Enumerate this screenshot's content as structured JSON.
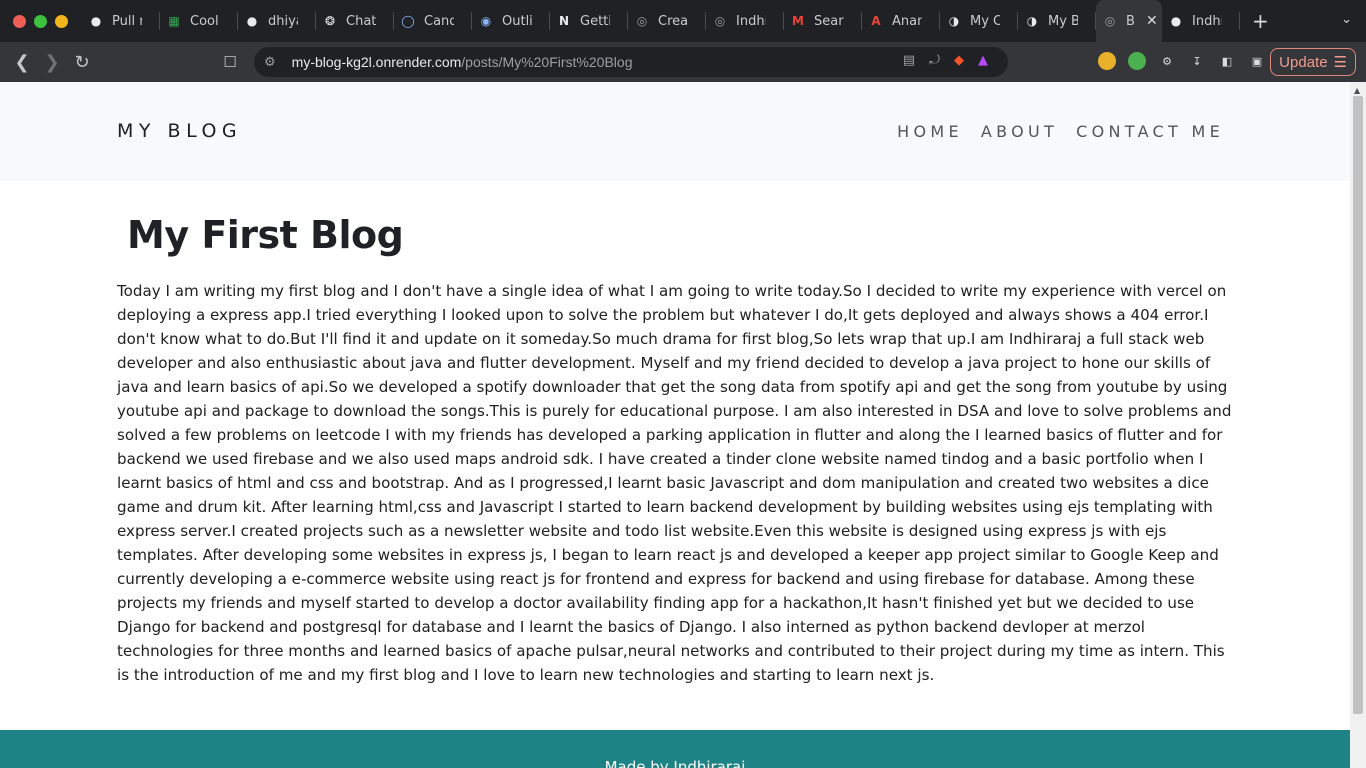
{
  "browser": {
    "tabs": [
      {
        "title": "Pull r",
        "icon": "github-icon",
        "color": "#e8eaed"
      },
      {
        "title": "Cool",
        "icon": "sheets-icon",
        "color": "#34a853"
      },
      {
        "title": "dhiya",
        "icon": "github-icon",
        "color": "#e8eaed"
      },
      {
        "title": "Chat",
        "icon": "chatgpt-icon",
        "color": "#e8eaed"
      },
      {
        "title": "Cand",
        "icon": "candidate-icon",
        "color": "#8ab4f8"
      },
      {
        "title": "Outli",
        "icon": "outlier-icon",
        "color": "#8ab4f8"
      },
      {
        "title": "Getti",
        "icon": "next-icon",
        "color": "#e8eaed"
      },
      {
        "title": "Crea",
        "icon": "globe-icon",
        "color": "#9aa0a6"
      },
      {
        "title": "Indhi",
        "icon": "globe-icon",
        "color": "#9aa0a6"
      },
      {
        "title": "Searc",
        "icon": "gmail-icon",
        "color": "#ea4335"
      },
      {
        "title": "Anan",
        "icon": "acrobat-icon",
        "color": "#e8453c"
      },
      {
        "title": "My C",
        "icon": "render-icon",
        "color": "#e8eaed"
      },
      {
        "title": "My B",
        "icon": "render-icon",
        "color": "#e8eaed"
      },
      {
        "title": "B",
        "icon": "globe-icon",
        "color": "#9aa0a6",
        "active": true
      },
      {
        "title": "Indhi",
        "icon": "github-icon",
        "color": "#e8eaed"
      }
    ],
    "url_host": "my-blog-kg2l.onrender.com",
    "url_path": "/posts/My%20First%20Blog",
    "update_label": "Update"
  },
  "site": {
    "brand": "MY BLOG",
    "nav": [
      "HOME",
      "ABOUT",
      "CONTACT ME"
    ],
    "footer": "Made by Indhiraraj"
  },
  "post": {
    "title": "My First Blog",
    "body": "Today I am writing my first blog and I don't have a single idea of what I am going to write today.So I decided to write my experience with vercel on deploying a express app.I tried everything I looked upon to solve the problem but whatever I do,It gets deployed and always shows a 404 error.I don't know what to do.But I'll find it and update on it someday.So much drama for first blog,So lets wrap that up.I am Indhiraraj a full stack web developer and also enthusiastic about java and flutter development. Myself and my friend decided to develop a java project to hone our skills of java and learn basics of api.So we developed a spotify downloader that get the song data from spotify api and get the song from youtube by using youtube api and package to download the songs.This is purely for educational purpose. I am also interested in DSA and love to solve problems and solved a few problems on leetcode I with my friends has developed a parking application in flutter and along the I learned basics of flutter and for backend we used firebase and we also used maps android sdk. I have created a tinder clone website named tindog and a basic portfolio when I learnt basics of html and css and bootstrap. And as I progressed,I learnt basic Javascript and dom manipulation and created two websites a dice game and drum kit. After learning html,css and Javascript I started to learn backend development by building websites using ejs templating with express server.I created projects such as a newsletter website and todo list website.Even this website is designed using express js with ejs templates. After developing some websites in express js, I began to learn react js and developed a keeper app project similar to Google Keep and currently developing a e-commerce website using react js for frontend and express for backend and using firebase for database. Among these projects my friends and myself started to develop a doctor availability finding app for a hackathon,It hasn't finished yet but we decided to use Django for backend and postgresql for database and I learnt the basics of Django. I also interned as python backend devloper at merzol technologies for three months and learned basics of apache pulsar,neural networks and contributed to their project during my time as intern. This is the introduction of me and my first blog and I love to learn new technologies and starting to learn next js."
  },
  "colors": {
    "header_bg": "#f8f9fa",
    "footer_bg": "#1e8384",
    "update_accent": "#f29b8e"
  }
}
